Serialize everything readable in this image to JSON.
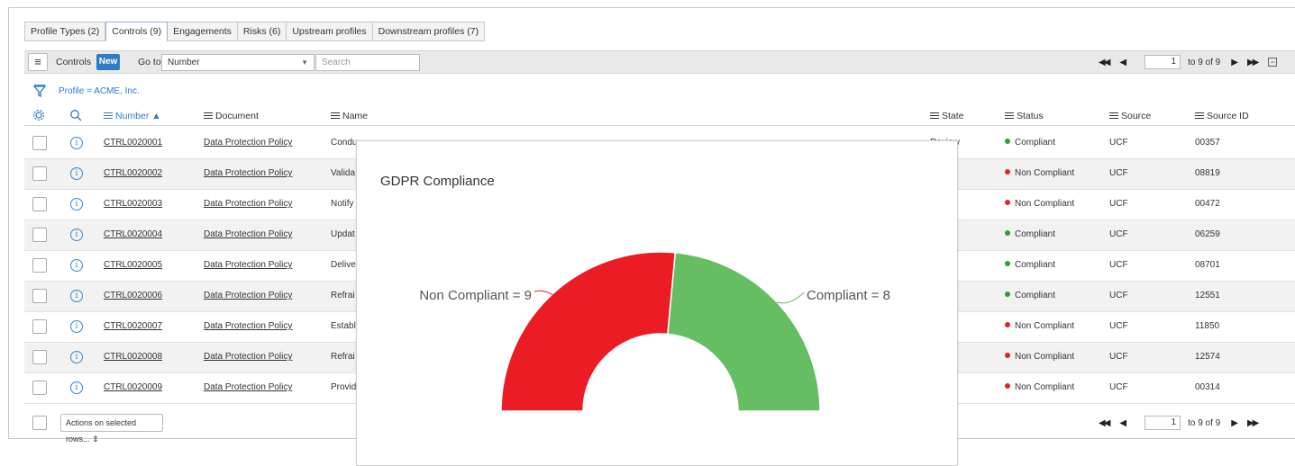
{
  "tabs": [
    {
      "label": "Profile Types (2)",
      "active": false
    },
    {
      "label": "Controls (9)",
      "active": true
    },
    {
      "label": "Engagements",
      "active": false
    },
    {
      "label": "Risks (6)",
      "active": false
    },
    {
      "label": "Upstream profiles",
      "active": false
    },
    {
      "label": "Downstream profiles (7)",
      "active": false
    }
  ],
  "toolbar": {
    "menu_icon": "hamburger-icon",
    "title": "Controls",
    "new_label": "New",
    "goto_label": "Go to",
    "goto_value": "Number",
    "search_placeholder": "Search"
  },
  "pager_top": {
    "page": "1",
    "range": "to 9 of 9"
  },
  "pager_bottom": {
    "page": "1",
    "range": "to 9 of 9"
  },
  "filter": {
    "icon": "filter-icon",
    "text": "Profile = ACME, Inc."
  },
  "columns": {
    "number": "Number ▲",
    "document": "Document",
    "name": "Name",
    "state": "State",
    "status": "Status",
    "source": "Source",
    "source_id": "Source ID"
  },
  "rows": [
    {
      "number": "CTRL0020001",
      "document": "Data Protection Policy",
      "name": "Condu",
      "state": "Review",
      "status": "Compliant",
      "source": "UCF",
      "source_id": "00357"
    },
    {
      "number": "CTRL0020002",
      "document": "Data Protection Policy",
      "name": "Valida",
      "state": "",
      "status": "Non Compliant",
      "source": "UCF",
      "source_id": "08819"
    },
    {
      "number": "CTRL0020003",
      "document": "Data Protection Policy",
      "name": "Notify",
      "state": "",
      "status": "Non Compliant",
      "source": "UCF",
      "source_id": "00472"
    },
    {
      "number": "CTRL0020004",
      "document": "Data Protection Policy",
      "name": "Updat",
      "state": "",
      "status": "Compliant",
      "source": "UCF",
      "source_id": "06259"
    },
    {
      "number": "CTRL0020005",
      "document": "Data Protection Policy",
      "name": "Delive",
      "state": "",
      "status": "Compliant",
      "source": "UCF",
      "source_id": "08701"
    },
    {
      "number": "CTRL0020006",
      "document": "Data Protection Policy",
      "name": "Refrai",
      "state": "",
      "status": "Compliant",
      "source": "UCF",
      "source_id": "12551"
    },
    {
      "number": "CTRL0020007",
      "document": "Data Protection Policy",
      "name": "Establ",
      "state": "",
      "status": "Non Compliant",
      "source": "UCF",
      "source_id": "11850"
    },
    {
      "number": "CTRL0020008",
      "document": "Data Protection Policy",
      "name": "Refrai",
      "state": "",
      "status": "Non Compliant",
      "source": "UCF",
      "source_id": "12574"
    },
    {
      "number": "CTRL0020009",
      "document": "Data Protection Policy",
      "name": "Provid",
      "state": "",
      "status": "Non Compliant",
      "source": "UCF",
      "source_id": "00314"
    }
  ],
  "status_colors": {
    "Compliant": "#2e9e3a",
    "Non Compliant": "#d9262c"
  },
  "footer": {
    "actions_label": "Actions on selected rows... ⇕"
  },
  "modal": {
    "title": "GDPR Compliance"
  },
  "chart_data": {
    "type": "pie",
    "subtype": "semi-donut gauge",
    "title": "GDPR Compliance",
    "categories": [
      "Non Compliant",
      "Compliant"
    ],
    "values": [
      9,
      8
    ],
    "labels": [
      "Non Compliant = 9",
      "Compliant = 8"
    ],
    "colors": [
      "#ec1c24",
      "#66bd63"
    ]
  }
}
